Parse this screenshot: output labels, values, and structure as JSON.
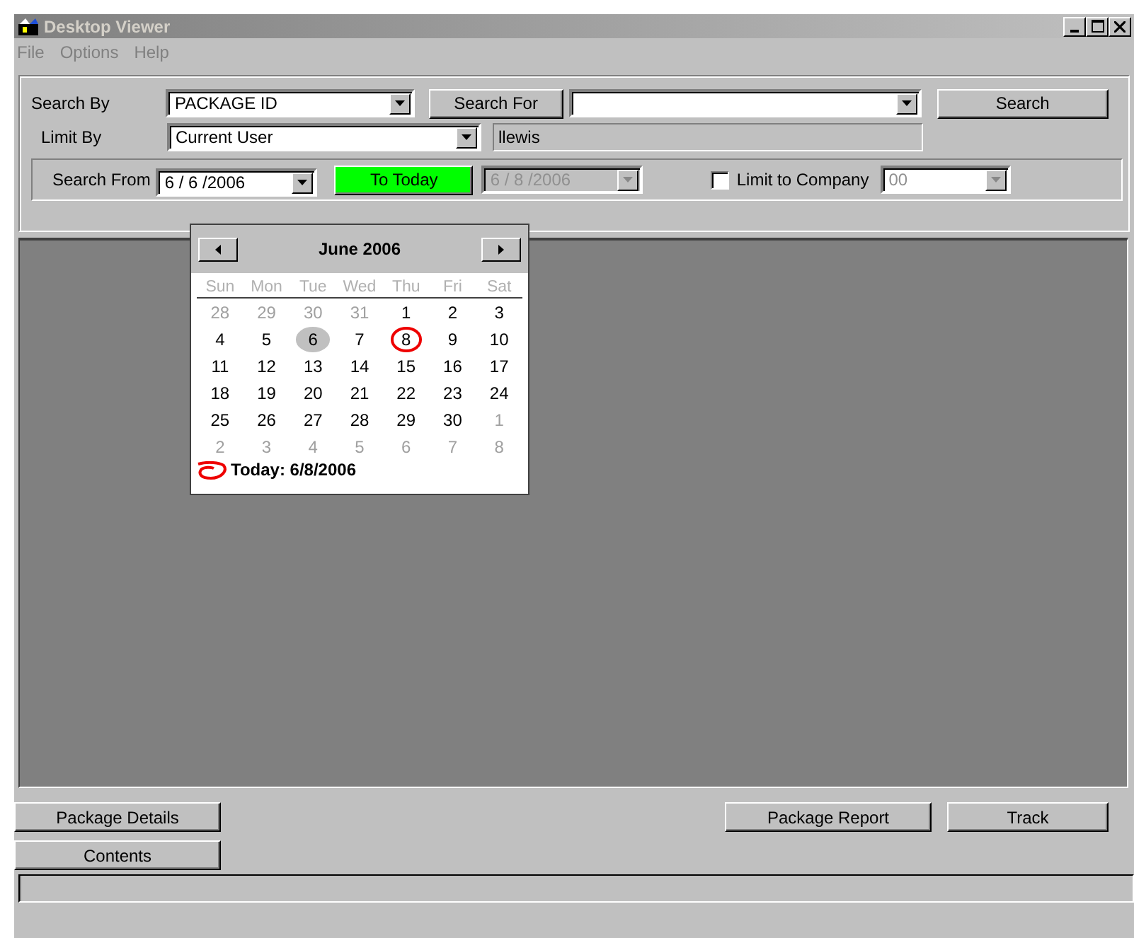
{
  "window": {
    "title": "Desktop Viewer",
    "active": false
  },
  "menu": [
    "File",
    "Options",
    "Help"
  ],
  "search": {
    "search_by_label": "Search By",
    "search_by_value": "PACKAGE ID",
    "search_for_button": "Search For",
    "search_button": "Search",
    "limit_by_label": "Limit By",
    "limit_by_value": "Current User",
    "user_value": "llewis"
  },
  "date_row": {
    "search_from_label": "Search From",
    "from_value": "6 / 6 /2006",
    "to_today_button": "To Today",
    "to_value": "6 / 8 /2006",
    "to_disabled": true,
    "limit_company_label": "Limit to Company",
    "limit_company_checked": false,
    "company_value": "00",
    "company_disabled": true
  },
  "calendar": {
    "month": "June 2006",
    "weekdays": [
      "Sun",
      "Mon",
      "Tue",
      "Wed",
      "Thu",
      "Fri",
      "Sat"
    ],
    "weeks": [
      [
        {
          "d": "28",
          "muted": true,
          "selected": false,
          "circled": false
        },
        {
          "d": "29",
          "muted": true,
          "selected": false,
          "circled": false
        },
        {
          "d": "30",
          "muted": true,
          "selected": false,
          "circled": false
        },
        {
          "d": "31",
          "muted": true,
          "selected": false,
          "circled": false
        },
        {
          "d": "1",
          "muted": false,
          "selected": false,
          "circled": false
        },
        {
          "d": "2",
          "muted": false,
          "selected": false,
          "circled": false
        },
        {
          "d": "3",
          "muted": false,
          "selected": false,
          "circled": false
        }
      ],
      [
        {
          "d": "4",
          "muted": false,
          "selected": false,
          "circled": false
        },
        {
          "d": "5",
          "muted": false,
          "selected": false,
          "circled": false
        },
        {
          "d": "6",
          "muted": false,
          "selected": true,
          "circled": false
        },
        {
          "d": "7",
          "muted": false,
          "selected": false,
          "circled": false
        },
        {
          "d": "8",
          "muted": false,
          "selected": false,
          "circled": true
        },
        {
          "d": "9",
          "muted": false,
          "selected": false,
          "circled": false
        },
        {
          "d": "10",
          "muted": false,
          "selected": false,
          "circled": false
        }
      ],
      [
        {
          "d": "11",
          "muted": false,
          "selected": false,
          "circled": false
        },
        {
          "d": "12",
          "muted": false,
          "selected": false,
          "circled": false
        },
        {
          "d": "13",
          "muted": false,
          "selected": false,
          "circled": false
        },
        {
          "d": "14",
          "muted": false,
          "selected": false,
          "circled": false
        },
        {
          "d": "15",
          "muted": false,
          "selected": false,
          "circled": false
        },
        {
          "d": "16",
          "muted": false,
          "selected": false,
          "circled": false
        },
        {
          "d": "17",
          "muted": false,
          "selected": false,
          "circled": false
        }
      ],
      [
        {
          "d": "18",
          "muted": false,
          "selected": false,
          "circled": false
        },
        {
          "d": "19",
          "muted": false,
          "selected": false,
          "circled": false
        },
        {
          "d": "20",
          "muted": false,
          "selected": false,
          "circled": false
        },
        {
          "d": "21",
          "muted": false,
          "selected": false,
          "circled": false
        },
        {
          "d": "22",
          "muted": false,
          "selected": false,
          "circled": false
        },
        {
          "d": "23",
          "muted": false,
          "selected": false,
          "circled": false
        },
        {
          "d": "24",
          "muted": false,
          "selected": false,
          "circled": false
        }
      ],
      [
        {
          "d": "25",
          "muted": false,
          "selected": false,
          "circled": false
        },
        {
          "d": "26",
          "muted": false,
          "selected": false,
          "circled": false
        },
        {
          "d": "27",
          "muted": false,
          "selected": false,
          "circled": false
        },
        {
          "d": "28",
          "muted": false,
          "selected": false,
          "circled": false
        },
        {
          "d": "29",
          "muted": false,
          "selected": false,
          "circled": false
        },
        {
          "d": "30",
          "muted": false,
          "selected": false,
          "circled": false
        },
        {
          "d": "1",
          "muted": true,
          "selected": false,
          "circled": false
        }
      ],
      [
        {
          "d": "2",
          "muted": true,
          "selected": false,
          "circled": false
        },
        {
          "d": "3",
          "muted": true,
          "selected": false,
          "circled": false
        },
        {
          "d": "4",
          "muted": true,
          "selected": false,
          "circled": false
        },
        {
          "d": "5",
          "muted": true,
          "selected": false,
          "circled": false
        },
        {
          "d": "6",
          "muted": true,
          "selected": false,
          "circled": false
        },
        {
          "d": "7",
          "muted": true,
          "selected": false,
          "circled": false
        },
        {
          "d": "8",
          "muted": true,
          "selected": false,
          "circled": false
        }
      ]
    ],
    "today": "Today: 6/8/2006"
  },
  "buttons_left": [
    "Package Details",
    "Contents"
  ],
  "buttons_right": [
    "Package Report",
    "Track"
  ]
}
